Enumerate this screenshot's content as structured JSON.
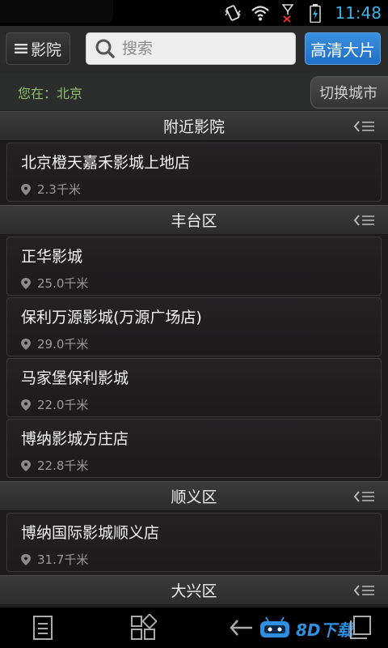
{
  "status_bar": {
    "time": "11:48"
  },
  "toolbar": {
    "cinema_label": "影院",
    "search_placeholder": "搜索",
    "hd_label": "高清大片"
  },
  "location": {
    "current": "您在：北京",
    "switch_label": "切换城市"
  },
  "sections": [
    {
      "title": "附近影院",
      "cinemas": [
        {
          "name": "北京橙天嘉禾影城上地店",
          "distance": "2.3千米"
        }
      ]
    },
    {
      "title": "丰台区",
      "cinemas": [
        {
          "name": "正华影城",
          "distance": "25.0千米"
        },
        {
          "name": "保利万源影城(万源广场店)",
          "distance": "29.0千米"
        },
        {
          "name": "马家堡保利影城",
          "distance": "22.0千米"
        },
        {
          "name": "博纳影城方庄店",
          "distance": "22.8千米"
        }
      ]
    },
    {
      "title": "顺义区",
      "cinemas": [
        {
          "name": "博纳国际影城顺义店",
          "distance": "31.7千米"
        }
      ]
    },
    {
      "title": "大兴区",
      "cinemas": []
    }
  ],
  "watermark": "8D下载",
  "colors": {
    "accent_blue": "#35b5e5",
    "location_green": "#8fbf6a",
    "hd_button": "#2a7fd6"
  }
}
